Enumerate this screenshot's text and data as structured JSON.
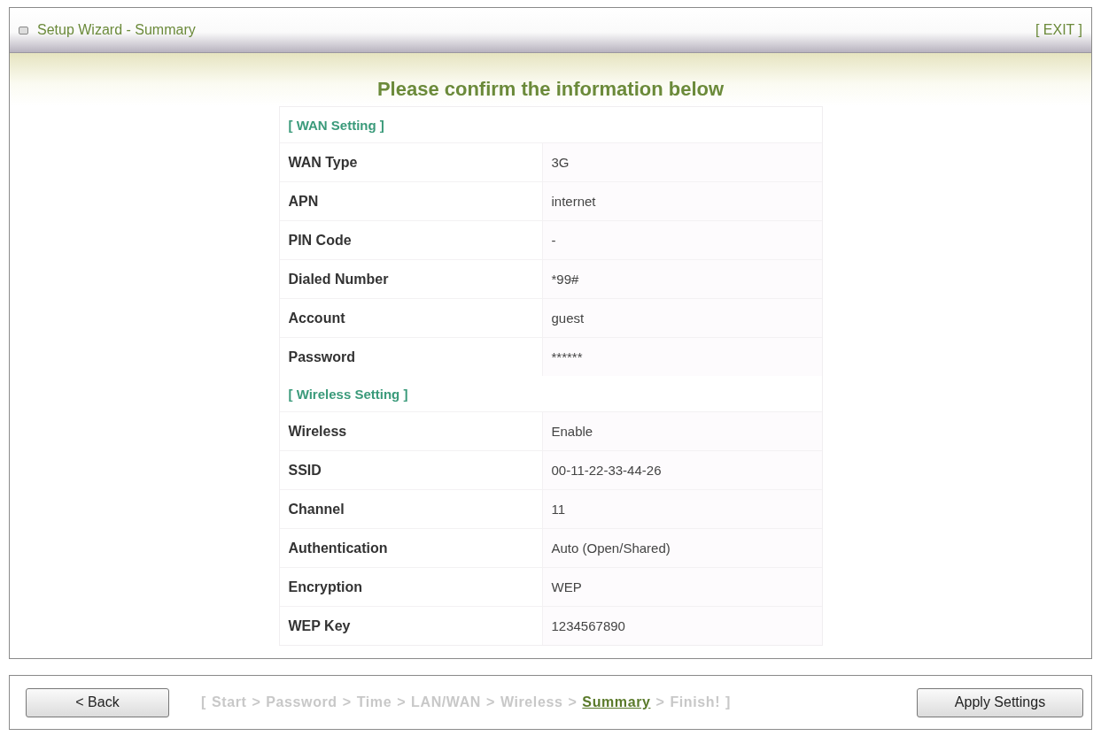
{
  "window": {
    "title": "Setup Wizard - Summary",
    "exit": "[ EXIT ]"
  },
  "heading": "Please confirm the information below",
  "sections": [
    {
      "title": "[ WAN Setting ]",
      "rows": [
        {
          "label": "WAN Type",
          "value": "3G"
        },
        {
          "label": "APN",
          "value": "internet"
        },
        {
          "label": "PIN Code",
          "value": "-"
        },
        {
          "label": "Dialed Number",
          "value": "*99#"
        },
        {
          "label": "Account",
          "value": "guest"
        },
        {
          "label": "Password",
          "value": "******"
        }
      ]
    },
    {
      "title": "[ Wireless Setting ]",
      "rows": [
        {
          "label": "Wireless",
          "value": "Enable"
        },
        {
          "label": "SSID",
          "value": "00-11-22-33-44-26"
        },
        {
          "label": "Channel",
          "value": "11"
        },
        {
          "label": "Authentication",
          "value": "Auto (Open/Shared)"
        },
        {
          "label": "Encryption",
          "value": "WEP"
        },
        {
          "label": "WEP Key",
          "value": "1234567890"
        }
      ]
    }
  ],
  "footer": {
    "back": "< Back",
    "apply": "Apply Settings",
    "open_bracket": "[",
    "close_bracket": "]",
    "separator": ">",
    "steps": [
      {
        "label": "Start",
        "selected": false
      },
      {
        "label": "Password",
        "selected": false
      },
      {
        "label": "Time",
        "selected": false
      },
      {
        "label": "LAN/WAN",
        "selected": false
      },
      {
        "label": "Wireless",
        "selected": false
      },
      {
        "label": "Summary",
        "selected": true
      },
      {
        "label": "Finish!",
        "selected": false
      }
    ]
  }
}
